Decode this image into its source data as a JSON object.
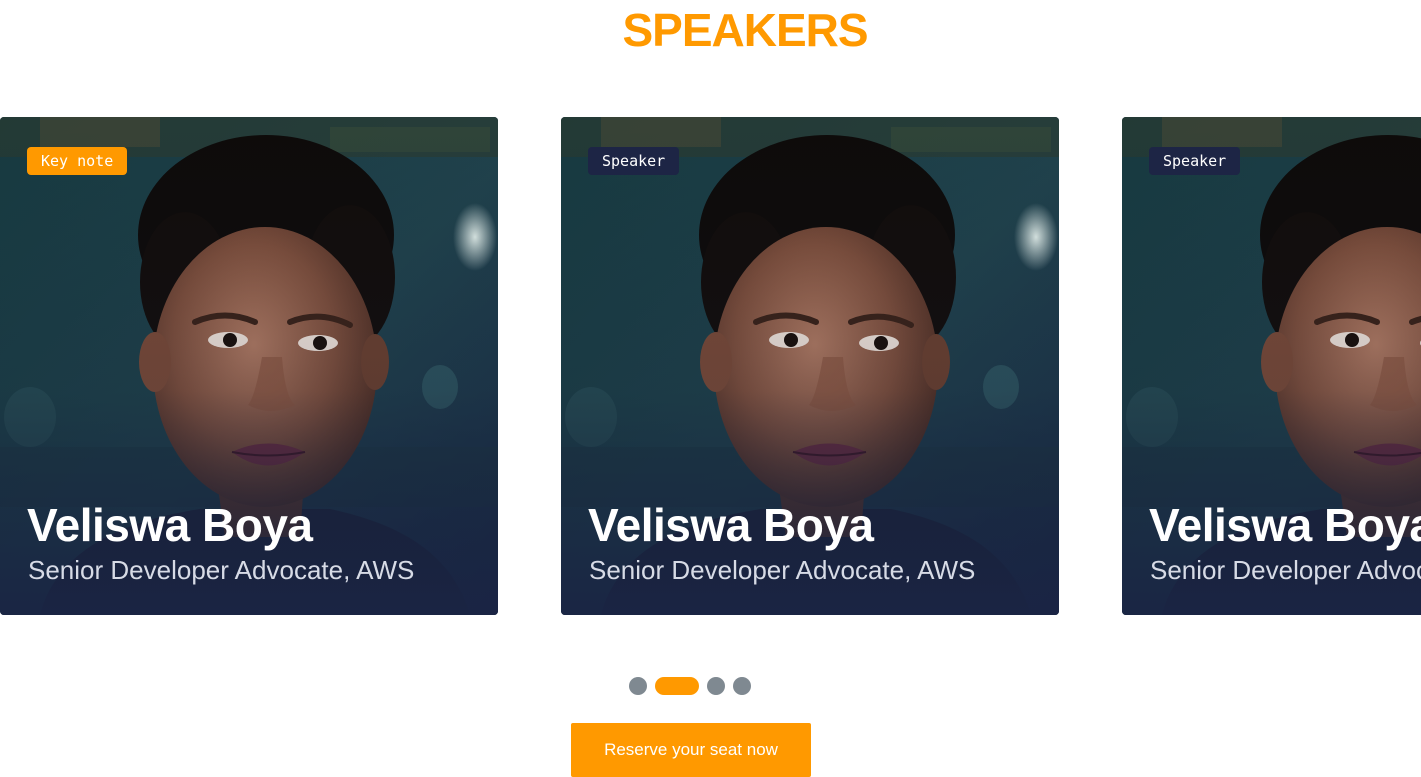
{
  "section": {
    "title": "SPEAKERS"
  },
  "speakers": [
    {
      "badge": "Key note",
      "name": "Veliswa Boya",
      "role": "Senior Developer Advocate, AWS"
    },
    {
      "badge": "Speaker",
      "name": "Veliswa Boya",
      "role": "Senior Developer Advocate, AWS"
    },
    {
      "badge": "Speaker",
      "name": "Veliswa Boya",
      "role": "Senior Developer Advocate, AWS"
    }
  ],
  "carousel": {
    "slide_count": 4,
    "active_index": 1
  },
  "cta": {
    "label": "Reserve your seat now"
  },
  "colors": {
    "accent": "#ff9900",
    "badge_speaker": "#1d2545",
    "card_bg": "#14213a",
    "dot_inactive": "#7f8991"
  },
  "icons": {
    "speaker_photo": "speaker-portrait-image"
  }
}
